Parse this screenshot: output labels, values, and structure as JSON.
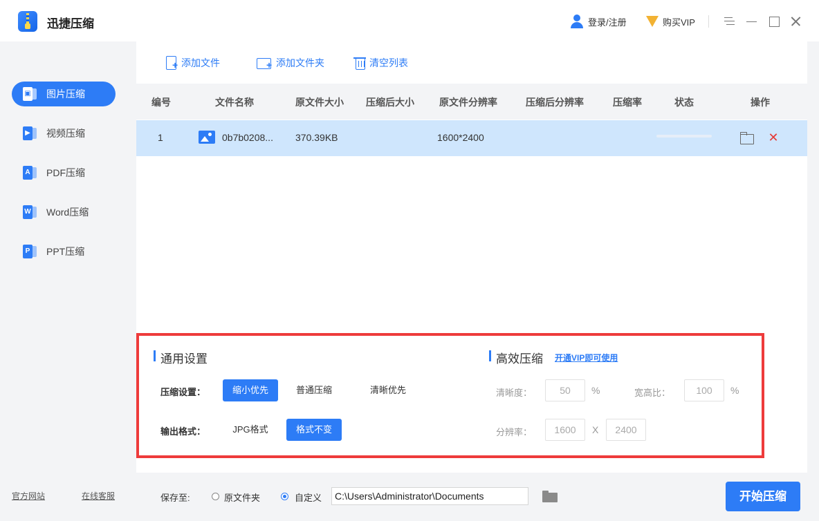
{
  "app": {
    "title": "迅捷压缩",
    "login_label": "登录/注册",
    "vip_label": "购买VIP"
  },
  "sidebar": {
    "items": [
      {
        "label": "图片压缩",
        "icon": "image-compress-icon",
        "glyph": "▣",
        "active": true
      },
      {
        "label": "视频压缩",
        "icon": "video-compress-icon",
        "glyph": "▶",
        "active": false
      },
      {
        "label": "PDF压缩",
        "icon": "pdf-compress-icon",
        "glyph": "A",
        "active": false
      },
      {
        "label": "Word压缩",
        "icon": "word-compress-icon",
        "glyph": "W",
        "active": false
      },
      {
        "label": "PPT压缩",
        "icon": "ppt-compress-icon",
        "glyph": "P",
        "active": false
      }
    ],
    "footer": {
      "website": "官方网站",
      "support": "在线客服"
    }
  },
  "toolbar": {
    "add_file": "添加文件",
    "add_folder": "添加文件夹",
    "clear_list": "清空列表"
  },
  "table": {
    "columns": [
      "编号",
      "文件名称",
      "原文件大小",
      "压缩后大小",
      "原文件分辨率",
      "压缩后分辨率",
      "压缩率",
      "状态",
      "操作"
    ],
    "rows": [
      {
        "index": "1",
        "filename": "0b7b0208...",
        "original_size": "370.39KB",
        "compressed_size": "",
        "original_resolution": "1600*2400",
        "compressed_resolution": "",
        "ratio": "",
        "progress": 0
      }
    ]
  },
  "settings": {
    "general_title": "通用设置",
    "compress_label": "压缩设置：",
    "compress_options": [
      "缩小优先",
      "普通压缩",
      "清晰优先"
    ],
    "compress_selected": 0,
    "format_label": "输出格式：",
    "format_options": [
      "JPG格式",
      "格式不变"
    ],
    "format_selected": 1,
    "efficient_title": "高效压缩",
    "vip_link": "开通VIP即可使用",
    "clarity_label": "清晰度：",
    "clarity_value": "50",
    "clarity_unit": "%",
    "aspect_label": "宽高比：",
    "aspect_value": "100",
    "aspect_unit": "%",
    "resolution_label": "分辨率：",
    "res_width": "1600",
    "res_x": "X",
    "res_height": "2400"
  },
  "output": {
    "save_label": "保存至:",
    "option_original": "原文件夹",
    "option_custom": "自定义",
    "selected": "custom",
    "path": "C:\\Users\\Administrator\\Documents",
    "start_button": "开始压缩"
  },
  "colors": {
    "accent": "#2d7cf6",
    "highlight_border": "#ee3b3b",
    "row_selected": "#cfe6fd",
    "delete": "#e53935"
  }
}
